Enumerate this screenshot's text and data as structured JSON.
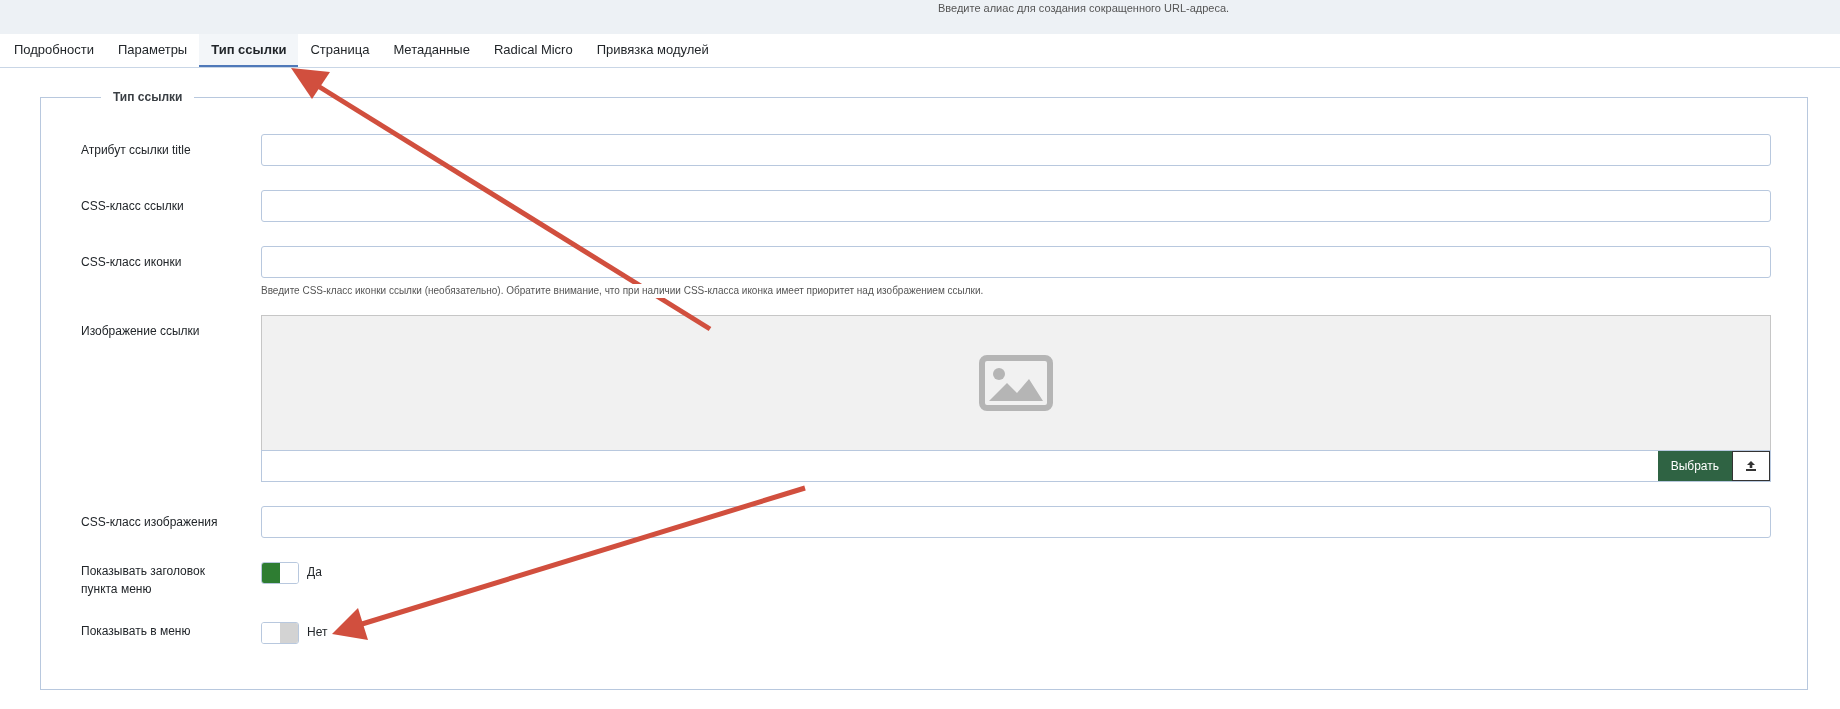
{
  "header_hint": "Введите алиас для создания сокращенного URL-адреса.",
  "tabs": [
    {
      "label": "Подробности",
      "selected": false
    },
    {
      "label": "Параметры",
      "selected": false
    },
    {
      "label": "Тип ссылки",
      "selected": true
    },
    {
      "label": "Страница",
      "selected": false
    },
    {
      "label": "Метаданные",
      "selected": false
    },
    {
      "label": "Radical Micro",
      "selected": false
    },
    {
      "label": "Привязка модулей",
      "selected": false
    }
  ],
  "fieldset": {
    "legend": "Тип ссылки",
    "fields": [
      {
        "kind": "text",
        "label": "Атрибут ссылки title"
      },
      {
        "kind": "text",
        "label": "CSS-класс ссылки"
      },
      {
        "kind": "text",
        "label": "CSS-класс иконки",
        "hint": "Введите CSS-класс иконки ссылки (необязательно). Обратите внимание, что при наличии CSS-класса иконка имеет приоритет над изображением ссылки."
      },
      {
        "kind": "media",
        "label": "Изображение ссылки",
        "button": "Выбрать"
      },
      {
        "kind": "text",
        "label": "CSS-класс изображения"
      },
      {
        "kind": "switch",
        "label": "Показывать заголовок пункта меню",
        "on": true,
        "value_label": "Да"
      },
      {
        "kind": "switch",
        "label": "Показывать в меню",
        "on": false,
        "value_label": "Нет"
      }
    ]
  }
}
